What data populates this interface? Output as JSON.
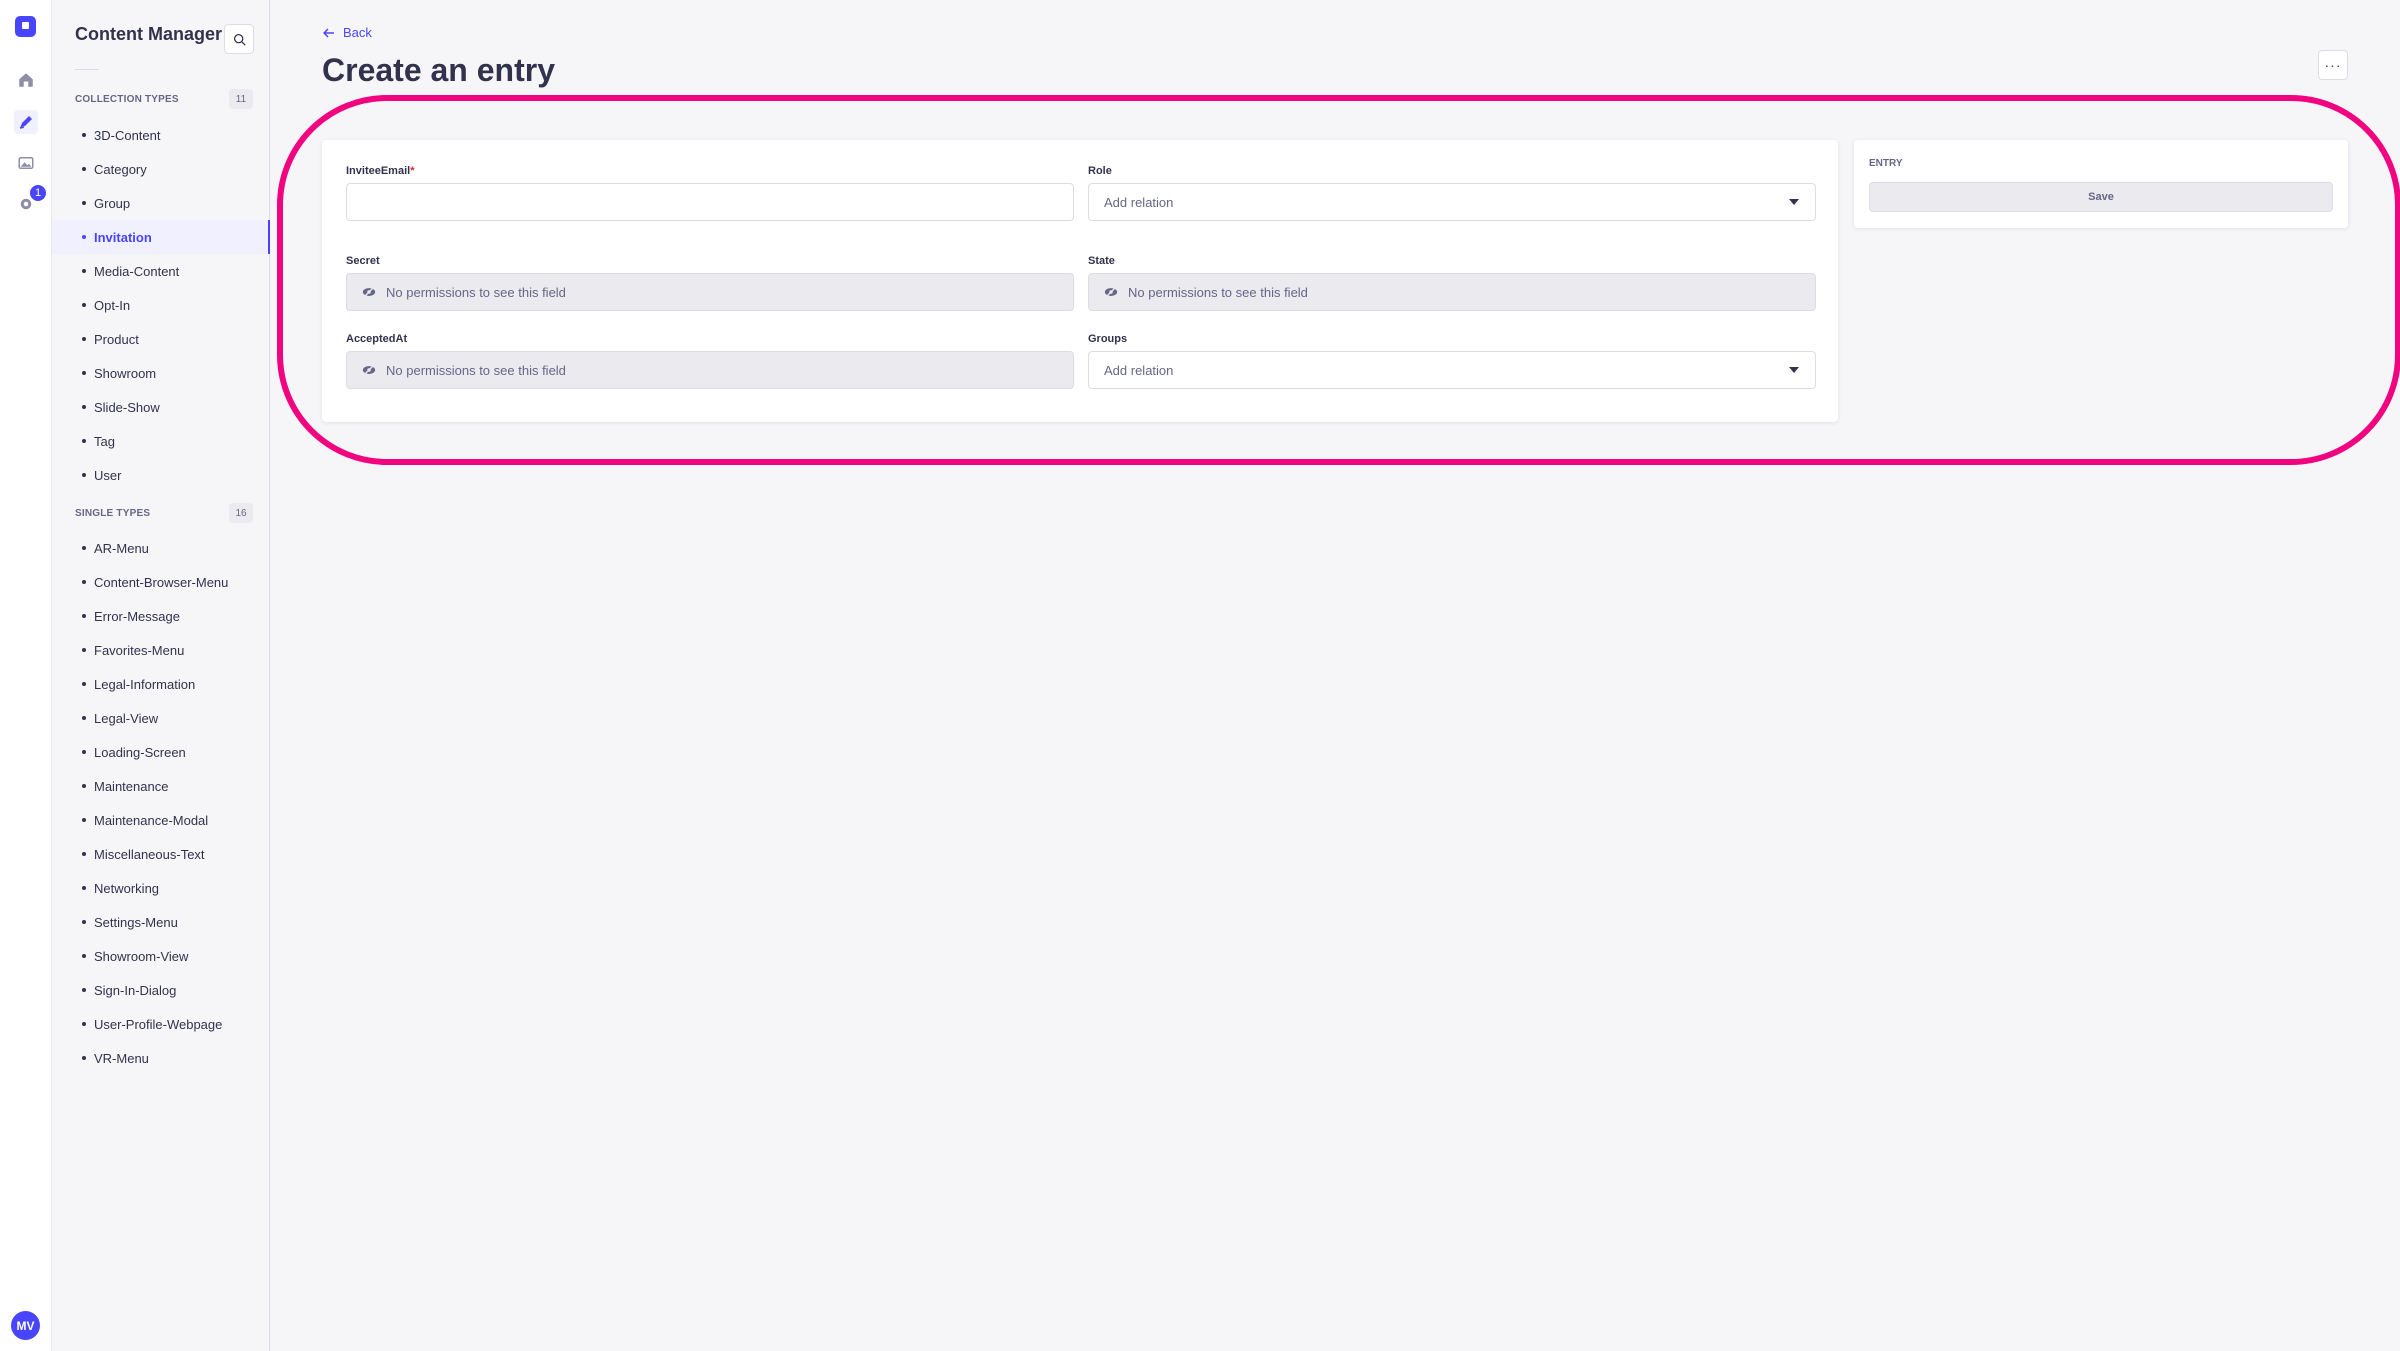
{
  "rail": {
    "badge_count": "1",
    "avatar_initials": "MV",
    "accent": "#4945ff"
  },
  "sidebar": {
    "title": "Content Manager",
    "collection_types": {
      "label": "Collection Types",
      "count": "11",
      "items": [
        "3D-Content",
        "Category",
        "Group",
        "Invitation",
        "Media-Content",
        "Opt-In",
        "Product",
        "Showroom",
        "Slide-Show",
        "Tag",
        "User"
      ]
    },
    "single_types": {
      "label": "Single Types",
      "count": "16",
      "items": [
        "AR-Menu",
        "Content-Browser-Menu",
        "Error-Message",
        "Favorites-Menu",
        "Legal-Information",
        "Legal-View",
        "Loading-Screen",
        "Maintenance",
        "Maintenance-Modal",
        "Miscellaneous-Text",
        "Networking",
        "Settings-Menu",
        "Showroom-View",
        "Sign-In-Dialog",
        "User-Profile-Webpage",
        "VR-Menu"
      ]
    },
    "active_item": "Invitation"
  },
  "header": {
    "back_label": "Back",
    "title": "Create an entry",
    "more_label": "···"
  },
  "form": {
    "invitee_email": {
      "label": "InviteeEmail",
      "required_mark": "*",
      "value": ""
    },
    "role": {
      "label": "Role",
      "placeholder": "Add relation"
    },
    "secret": {
      "label": "Secret",
      "value": "No permissions to see this field"
    },
    "state": {
      "label": "State",
      "value": "No permissions to see this field"
    },
    "accepted_at": {
      "label": "AcceptedAt",
      "value": "No permissions to see this field"
    },
    "groups": {
      "label": "Groups",
      "placeholder": "Add relation"
    }
  },
  "entry_panel": {
    "title": "Entry",
    "save_label": "Save"
  },
  "highlight_color": "#f0047f"
}
